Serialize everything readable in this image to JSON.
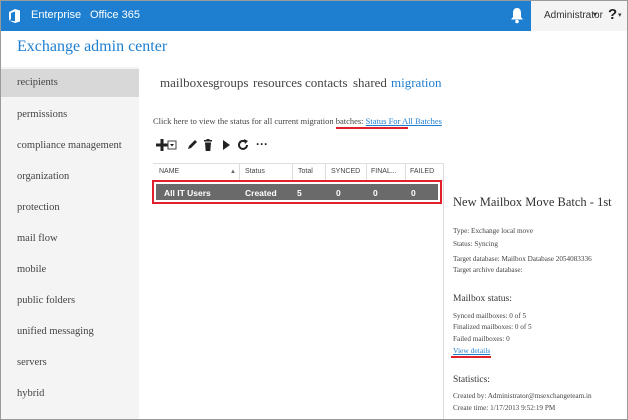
{
  "topbar": {
    "office_icon": "office-logo-icon",
    "nav": [
      "Enterprise",
      "Office 365"
    ],
    "notification_icon": "bell-icon",
    "account_name": "Administrator",
    "account_caret": "▾",
    "help_label": "?",
    "help_caret": "▾"
  },
  "app_title": "Exchange admin center",
  "sidebar": {
    "items": [
      {
        "label": "recipients",
        "selected": true
      },
      {
        "label": "permissions"
      },
      {
        "label": "compliance management"
      },
      {
        "label": "organization"
      },
      {
        "label": "protection"
      },
      {
        "label": "mail flow"
      },
      {
        "label": "mobile"
      },
      {
        "label": "public folders"
      },
      {
        "label": "unified messaging"
      },
      {
        "label": "servers"
      },
      {
        "label": "hybrid"
      }
    ]
  },
  "tabs": [
    {
      "label": "mailboxes"
    },
    {
      "label": "groups"
    },
    {
      "label": "resources"
    },
    {
      "label": "contacts"
    },
    {
      "label": "shared"
    },
    {
      "label": "migration",
      "active": true
    }
  ],
  "info": {
    "text": "Click here to view the status for all current migration batches:",
    "link": "Status For All Batches"
  },
  "toolbar": {
    "icons": [
      "add-icon",
      "dropdown-caret-icon",
      "edit-icon",
      "delete-icon",
      "start-icon",
      "refresh-icon",
      "more-icon"
    ],
    "more_label": "···"
  },
  "grid": {
    "columns": [
      "NAME",
      "Status",
      "Total",
      "SYNCED",
      "FINAL...",
      "FAILED"
    ],
    "sort_indicator": "▲",
    "rows": [
      {
        "name": "All IT Users",
        "status": "Created",
        "total": "5",
        "synced": "0",
        "finalized": "0",
        "failed": "0",
        "selected": true
      }
    ]
  },
  "details": {
    "title": "New Mailbox Move Batch - 1st",
    "type": "Type: Exchange local move",
    "status": "Status: Syncing",
    "target_db": "Target database: Mailbox Database 2054083336",
    "target_archive": "Target archive database:",
    "mailbox_status_heading": "Mailbox status:",
    "synced": "Synced mailboxes: 0 of 5",
    "finalized": "Finalized mailboxes: 0 of 5",
    "failed": "Failed mailboxes: 0",
    "view_details": "View details",
    "statistics_heading": "Statistics:",
    "created_by": "Created by: Administrator@msexchangeteam.in",
    "create_time": "Create time: 1/17/2013 9:52:19 PM"
  },
  "colors": {
    "accent": "#1e7fd0",
    "highlight_red": "#e0202a",
    "selected_row": "#6a6a6a"
  }
}
